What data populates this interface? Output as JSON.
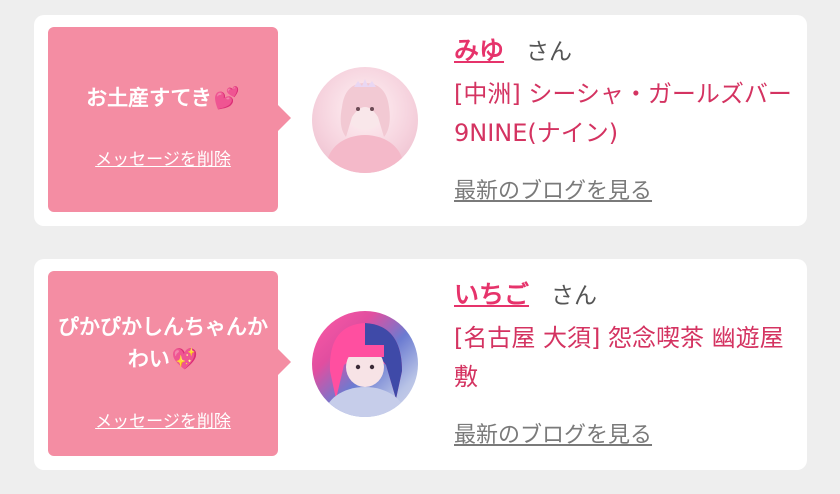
{
  "messages": [
    {
      "bubble_text": "お土産すてき",
      "bubble_emoji": "💕",
      "bubble_emoji_icon": "two-hearts-icon",
      "delete_label": "メッセージを削除",
      "name": "みゆ",
      "honorific": "さん",
      "shop": "[中洲] シーシャ・ガールズバー 9NINE(ナイン)",
      "blog_label": "最新のブログを見る"
    },
    {
      "bubble_text": "ぴかぴかしんちゃんかわい",
      "bubble_emoji": "💖",
      "bubble_emoji_icon": "sparkling-heart-icon",
      "delete_label": "メッセージを削除",
      "name": "いちご",
      "honorific": "さん",
      "shop": "[名古屋 大須] 怨念喫茶 幽遊屋敷",
      "blog_label": "最新のブログを見る"
    }
  ],
  "colors": {
    "bubble": "#f48da3",
    "name": "#e6336b",
    "shop": "#d43361",
    "link": "#7a7a7a",
    "background": "#eeeeee"
  }
}
